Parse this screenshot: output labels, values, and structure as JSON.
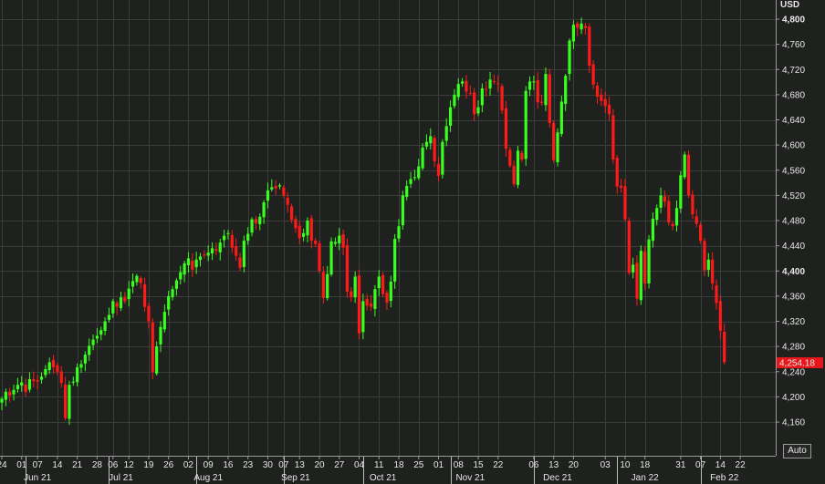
{
  "currency": "USD",
  "auto_label": "Auto",
  "colors": {
    "up": "#39ff1e",
    "down": "#ff1a1a",
    "grid": "#3a3d3a",
    "background": "#1f211f",
    "last_price_bg": "#e8161b"
  },
  "chart_data": {
    "type": "candlestick",
    "unit": "USD",
    "ylim": [
      4130,
      4825
    ],
    "y_ticks": [
      4160,
      4200,
      4240,
      4280,
      4320,
      4360,
      4400,
      4440,
      4480,
      4520,
      4560,
      4600,
      4640,
      4680,
      4720,
      4760,
      4800
    ],
    "y_tick_labels": [
      "4,160",
      "4,200",
      "4,240",
      "4,280",
      "4,320",
      "4,360",
      "4,400",
      "4,440",
      "4,480",
      "4,520",
      "4,560",
      "4,600",
      "4,640",
      "4,680",
      "4,720",
      "4,760",
      "4,800"
    ],
    "emphasized_ticks": [
      "4,400",
      "4,800"
    ],
    "last_price": 4254.18,
    "last_price_label": "4,254.18",
    "day_ticks": [
      {
        "label": "24",
        "day": 0
      },
      {
        "label": "01",
        "day": 5
      },
      {
        "label": "07",
        "day": 9
      },
      {
        "label": "14",
        "day": 14
      },
      {
        "label": "21",
        "day": 19
      },
      {
        "label": "28",
        "day": 24
      },
      {
        "label": "06",
        "day": 28
      },
      {
        "label": "12",
        "day": 32
      },
      {
        "label": "19",
        "day": 37
      },
      {
        "label": "26",
        "day": 42
      },
      {
        "label": "02",
        "day": 47
      },
      {
        "label": "09",
        "day": 52
      },
      {
        "label": "16",
        "day": 57
      },
      {
        "label": "23",
        "day": 62
      },
      {
        "label": "30",
        "day": 67
      },
      {
        "label": "07",
        "day": 71
      },
      {
        "label": "13",
        "day": 75
      },
      {
        "label": "20",
        "day": 80
      },
      {
        "label": "27",
        "day": 85
      },
      {
        "label": "04",
        "day": 90
      },
      {
        "label": "11",
        "day": 95
      },
      {
        "label": "18",
        "day": 100
      },
      {
        "label": "25",
        "day": 105
      },
      {
        "label": "01",
        "day": 110
      },
      {
        "label": "08",
        "day": 115
      },
      {
        "label": "15",
        "day": 120
      },
      {
        "label": "22",
        "day": 125
      },
      {
        "label": "06",
        "day": 134
      },
      {
        "label": "13",
        "day": 139
      },
      {
        "label": "20",
        "day": 144
      },
      {
        "label": "03",
        "day": 152
      },
      {
        "label": "10",
        "day": 157
      },
      {
        "label": "18",
        "day": 162
      },
      {
        "label": "31",
        "day": 171
      },
      {
        "label": "07",
        "day": 176
      },
      {
        "label": "14",
        "day": 181
      },
      {
        "label": "22",
        "day": 186
      }
    ],
    "month_labels": [
      {
        "label": "Jun 21",
        "day": 9
      },
      {
        "label": "Jul 21",
        "day": 30
      },
      {
        "label": "Aug 21",
        "day": 52
      },
      {
        "label": "Sep 21",
        "day": 74
      },
      {
        "label": "Oct 21",
        "day": 96
      },
      {
        "label": "Nov 21",
        "day": 118
      },
      {
        "label": "Dec 21",
        "day": 140
      },
      {
        "label": "Jan 22",
        "day": 162
      },
      {
        "label": "Feb 22",
        "day": 182
      }
    ],
    "month_separators": [
      6,
      27,
      49,
      71,
      91,
      113,
      134,
      155,
      176
    ],
    "closes": [
      4197,
      4208,
      4202,
      4211,
      4219,
      4223,
      4208,
      4228,
      4225,
      4224,
      4232,
      4244,
      4255,
      4247,
      4240,
      4222,
      4166,
      4219,
      4224,
      4247,
      4252,
      4267,
      4281,
      4291,
      4297,
      4306,
      4320,
      4330,
      4352,
      4343,
      4358,
      4352,
      4372,
      4384,
      4392,
      4381,
      4343,
      4320,
      4240,
      4280,
      4311,
      4335,
      4360,
      4371,
      4385,
      4398,
      4412,
      4420,
      4402,
      4418,
      4423,
      4425,
      4429,
      4436,
      4432,
      4445,
      4456,
      4460,
      4437,
      4424,
      4405,
      4448,
      4459,
      4482,
      4476,
      4486,
      4509,
      4528,
      4533,
      4531,
      4536,
      4520,
      4505,
      4481,
      4468,
      4452,
      4460,
      4480,
      4448,
      4443,
      4400,
      4357,
      4395,
      4447,
      4446,
      4456,
      4437,
      4367,
      4358,
      4391,
      4301,
      4352,
      4345,
      4343,
      4371,
      4391,
      4363,
      4350,
      4383,
      4451,
      4471,
      4520,
      4535,
      4546,
      4549,
      4566,
      4596,
      4605,
      4614,
      4574,
      4551,
      4605,
      4630,
      4660,
      4680,
      4697,
      4701,
      4685,
      4682,
      4649,
      4660,
      4690,
      4688,
      4704,
      4701,
      4697,
      4655,
      4594,
      4567,
      4538,
      4591,
      4577,
      4686,
      4701,
      4701,
      4668,
      4667,
      4713,
      4635,
      4576,
      4620,
      4669,
      4710,
      4766,
      4791,
      4786,
      4793,
      4786,
      4726,
      4696,
      4677,
      4670,
      4662,
      4649,
      4577,
      4534,
      4532,
      4482,
      4397,
      4410,
      4356,
      4432,
      4380,
      4450,
      4483,
      4500,
      4520,
      4510,
      4477,
      4471,
      4500,
      4552,
      4585,
      4520,
      4490,
      4475,
      4448,
      4401,
      4418,
      4380,
      4349,
      4305,
      4255
    ]
  }
}
